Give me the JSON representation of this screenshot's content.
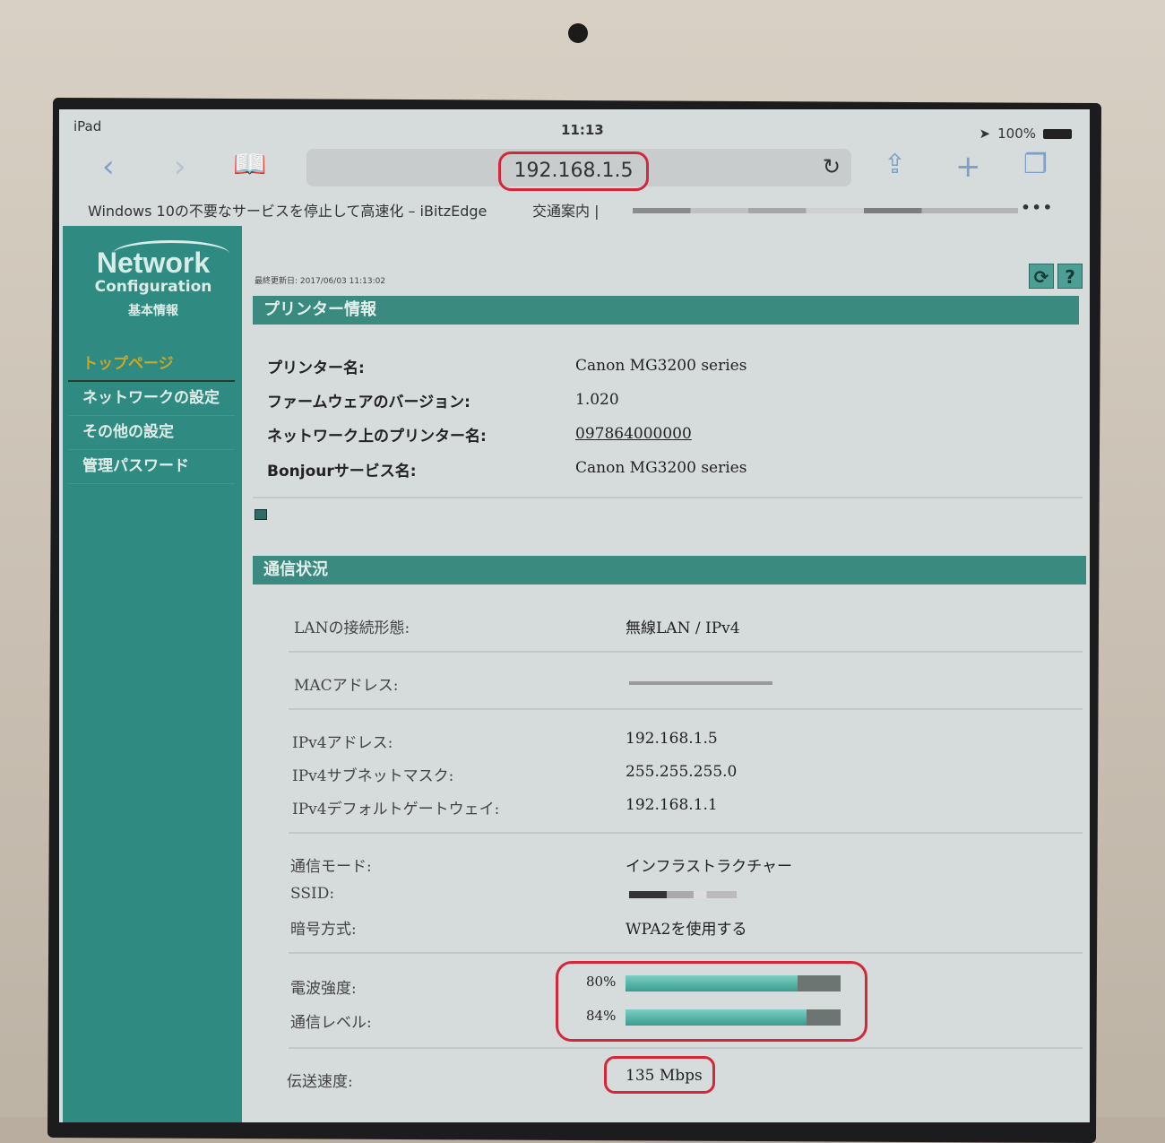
{
  "status_bar": {
    "device": "iPad",
    "time": "11:13",
    "battery": "100%"
  },
  "browser": {
    "url": "192.168.1.5",
    "bookmarks": [
      "Windows 10の不要なサービスを停止して高速化 – iBitzEdge",
      "交通案内 |"
    ],
    "more": "•••"
  },
  "sidebar": {
    "logo_title": "Network",
    "logo_subtitle": "Configuration",
    "logo_caption": "基本情報",
    "items": [
      "トップページ",
      "ネットワークの設定",
      "その他の設定",
      "管理パスワード"
    ]
  },
  "main": {
    "last_updated": "最終更新日: 2017/06/03 11:13:02",
    "printer_section": {
      "title": "プリンター情報",
      "rows": [
        {
          "label": "プリンター名:",
          "value": "Canon MG3200 series"
        },
        {
          "label": "ファームウェアのバージョン:",
          "value": "1.020"
        },
        {
          "label": "ネットワーク上のプリンター名:",
          "value": "097864000000"
        },
        {
          "label": "Bonjourサービス名:",
          "value": "Canon MG3200 series"
        }
      ]
    },
    "comm_section": {
      "title": "通信状況",
      "rows": [
        {
          "label": "LANの接続形態:",
          "value": "無線LAN / IPv4"
        },
        {
          "label": "MACアドレス:",
          "value": ""
        },
        {
          "label": "IPv4アドレス:",
          "value": "192.168.1.5"
        },
        {
          "label": "IPv4サブネットマスク:",
          "value": "255.255.255.0"
        },
        {
          "label": "IPv4デフォルトゲートウェイ:",
          "value": "192.168.1.1"
        },
        {
          "label": "通信モード:",
          "value": "インフラストラクチャー"
        },
        {
          "label": "SSID:",
          "value": ""
        },
        {
          "label": "暗号方式:",
          "value": "WPA2を使用する"
        },
        {
          "label": "電波強度:",
          "value": "80%",
          "level": 80
        },
        {
          "label": "通信レベル:",
          "value": "84%",
          "level": 84
        },
        {
          "label": "伝送速度:",
          "value": "135 Mbps"
        }
      ]
    }
  },
  "colors": {
    "accent": "#2f8a82",
    "highlight": "#d5273a"
  }
}
